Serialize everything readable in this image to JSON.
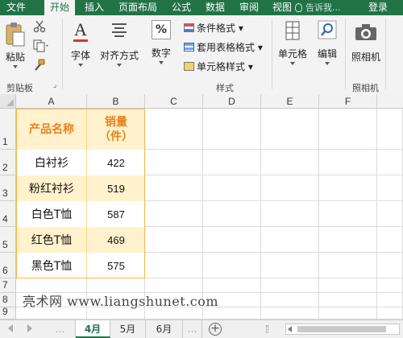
{
  "menu": {
    "items": [
      "文件",
      "开始",
      "插入",
      "页面布局",
      "公式",
      "数据",
      "审阅",
      "视图"
    ],
    "active_index": 1,
    "tell_me": "告诉我...",
    "login": "登录"
  },
  "ribbon": {
    "clipboard": {
      "paste": "粘贴",
      "group_label": "剪贴板"
    },
    "font": {
      "label": "字体",
      "icon_letter": "A"
    },
    "alignment": {
      "label": "对齐方式"
    },
    "number": {
      "label": "数字",
      "icon_symbol": "%"
    },
    "styles": {
      "conditional_format": "条件格式",
      "table_format": "套用表格格式",
      "cell_styles": "单元格样式",
      "group_label": "样式"
    },
    "cells": {
      "label": "单元格"
    },
    "editing": {
      "label": "编辑"
    },
    "camera": {
      "label": "照相机",
      "group_label": "照相机"
    }
  },
  "sheet": {
    "columns": [
      "A",
      "B",
      "C",
      "D",
      "E",
      "F"
    ],
    "rows": [
      "1",
      "2",
      "3",
      "4",
      "5",
      "6",
      "7",
      "8",
      "9"
    ],
    "header": {
      "product": "产品名称",
      "sales_line1": "销量",
      "sales_line2": "（件）"
    },
    "data": [
      {
        "product": "白衬衫",
        "sales": "422"
      },
      {
        "product": "粉红衬衫",
        "sales": "519"
      },
      {
        "product": "白色T恤",
        "sales": "587"
      },
      {
        "product": "红色T恤",
        "sales": "469"
      },
      {
        "product": "黑色T恤",
        "sales": "575"
      }
    ],
    "watermark": "亮术网 www.liangshunet.com"
  },
  "tabs": {
    "sheets": [
      "4月",
      "5月",
      "6月"
    ],
    "active_index": 0,
    "add_symbol": "+"
  },
  "colors": {
    "accent": "#217346",
    "header_text": "#e8821e",
    "band_fill": "#fff2cc",
    "table_border": "#f4b942"
  }
}
